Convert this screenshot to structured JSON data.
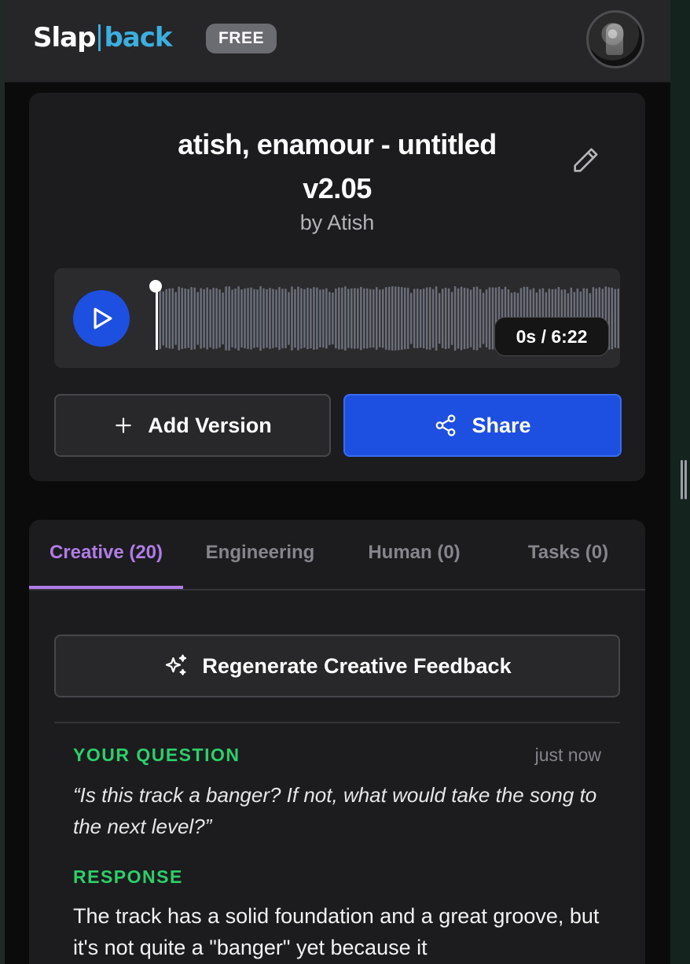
{
  "header": {
    "logo_part1": "Slap",
    "logo_part2": "back",
    "plan_badge": "FREE",
    "avatar_icon": "user-avatar"
  },
  "track": {
    "title": "atish, enamour - untitled v2.05",
    "artist": "by Atish",
    "time_display": "0s / 6:22",
    "progress": 0,
    "add_version_label": "Add Version",
    "share_label": "Share",
    "edit_icon": "pencil-icon",
    "play_icon": "play-icon",
    "add_icon": "plus-icon",
    "share_icon": "share-icon"
  },
  "tabs": [
    {
      "label": "Creative (20)",
      "active": true
    },
    {
      "label": "Engineering",
      "active": false
    },
    {
      "label": "Human (0)",
      "active": false
    },
    {
      "label": "Tasks (0)",
      "active": false
    }
  ],
  "feedback": {
    "regenerate_label": "Regenerate Creative Feedback",
    "regenerate_icon": "sparkles-icon",
    "question_heading": "YOUR QUESTION",
    "question_time": "just now",
    "question_text": "“Is this track a banger? If not, what would take the song to the next level?”",
    "response_heading": "RESPONSE",
    "response_text": "The track has a solid foundation and a great groove, but it's not quite a \"banger\" yet because it"
  },
  "colors": {
    "accent_blue": "#1d4fe0",
    "accent_purple": "#b07ce8",
    "accent_green": "#2bd06a",
    "logo_blue": "#3bb0e0"
  }
}
